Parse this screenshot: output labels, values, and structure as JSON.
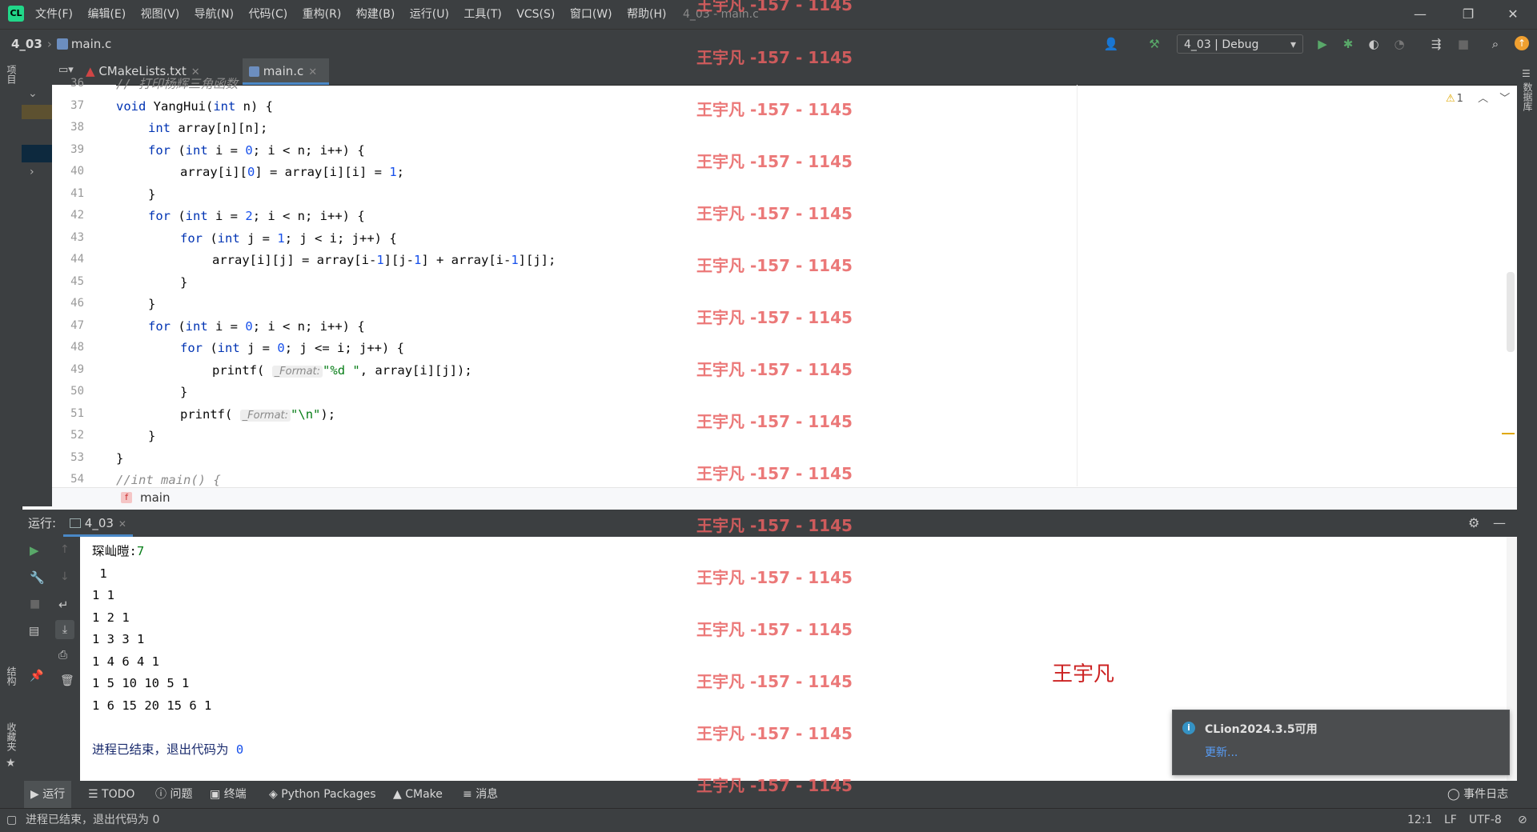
{
  "titlebar": {
    "menu": [
      "文件(F)",
      "编辑(E)",
      "视图(V)",
      "导航(N)",
      "代码(C)",
      "重构(R)",
      "构建(B)",
      "运行(U)",
      "工具(T)",
      "VCS(S)",
      "窗口(W)",
      "帮助(H)"
    ],
    "window_title": "4_03 - main.c",
    "minimize": "—",
    "restore": "❐",
    "close": "✕"
  },
  "navbar": {
    "project": "4_03",
    "file": "main.c",
    "run_config": "4_03 | Debug"
  },
  "left_strip": {
    "project_label": "项目",
    "structure_label": "结构",
    "bookmarks_label": "收藏夹"
  },
  "right_strip": {
    "database_label": "数据库"
  },
  "tabs": [
    {
      "label": "CMakeLists.txt"
    },
    {
      "label": "main.c"
    }
  ],
  "editor": {
    "warning_count": "1",
    "line_numbers": [
      "36",
      "37",
      "38",
      "39",
      "40",
      "41",
      "42",
      "43",
      "44",
      "45",
      "46",
      "47",
      "48",
      "49",
      "50",
      "51",
      "52",
      "53",
      "54"
    ],
    "hint_format": "_Format:",
    "breadcrumb_fn": "main",
    "breadcrumb_badge": "f",
    "code": {
      "l36": "// 打印杨辉三角函数",
      "l37_kw": "void",
      "l37_rest": " YangHui(",
      "l37_kw2": "int",
      "l37_end": " n) {",
      "l38_kw": "int",
      "l38_rest": " array[n][n];",
      "l39_a": "for",
      "l39_b": " (",
      "l39_c": "int",
      "l39_d": " i = ",
      "l39_e": "0",
      "l39_f": "; i < n; i++) {",
      "l40_a": "array[i][",
      "l40_b": "0",
      "l40_c": "] = array[i][i] = ",
      "l40_d": "1",
      "l40_e": ";",
      "l41": "}",
      "l42_a": "for",
      "l42_b": " (",
      "l42_c": "int",
      "l42_d": " i = ",
      "l42_e": "2",
      "l42_f": "; i < n; i++) {",
      "l43_a": "for",
      "l43_b": " (",
      "l43_c": "int",
      "l43_d": " j = ",
      "l43_e": "1",
      "l43_f": "; j < i; j++) {",
      "l44_a": "array[i][j] = array[i-",
      "l44_b": "1",
      "l44_c": "][j-",
      "l44_d": "1",
      "l44_e": "] + array[i-",
      "l44_f": "1",
      "l44_g": "][j];",
      "l45": "}",
      "l46": "}",
      "l47_a": "for",
      "l47_b": " (",
      "l47_c": "int",
      "l47_d": " i = ",
      "l47_e": "0",
      "l47_f": "; i < n; i++) {",
      "l48_a": "for",
      "l48_b": " (",
      "l48_c": "int",
      "l48_d": " j = ",
      "l48_e": "0",
      "l48_f": "; j <= i; j++) {",
      "l49_a": "printf( ",
      "l49_b": "\"%d \"",
      "l49_c": ", array[i][j]);",
      "l50": "}",
      "l51_a": "printf( ",
      "l51_b": "\"\\n\"",
      "l51_c": ");",
      "l52": "}",
      "l53": "}",
      "l54": "//int main() {"
    }
  },
  "run_panel": {
    "label": "运行:",
    "tab": "4_03",
    "output": [
      {
        "text": "琛屾暟:",
        "input": "7"
      },
      {
        "text": " 1"
      },
      {
        "text": "1 1"
      },
      {
        "text": "1 2 1"
      },
      {
        "text": "1 3 3 1"
      },
      {
        "text": "1 4 6 4 1"
      },
      {
        "text": "1 5 10 10 5 1"
      },
      {
        "text": "1 6 15 20 15 6 1"
      },
      {
        "text": ""
      },
      {
        "text": "进程已结束，退出代码为 ",
        "code": "0"
      }
    ]
  },
  "bottom_tools": {
    "run": "运行",
    "todo": "TODO",
    "problems": "问题",
    "terminal": "终端",
    "python_packages": "Python Packages",
    "cmake": "CMake",
    "messages": "消息",
    "event_log": "事件日志"
  },
  "statusbar": {
    "message": "进程已结束，退出代码为 0",
    "position": "12:1",
    "line_sep": "LF",
    "encoding": "UTF-8"
  },
  "notification": {
    "title": "CLion2024.3.5可用",
    "link": "更新..."
  },
  "watermark": {
    "text": "王宇凡 -157 - 1145",
    "name": "王宇凡"
  },
  "colors": {
    "chrome": "#3c3f41",
    "accent": "#4a88c7",
    "keyword": "#0033b3",
    "number": "#1750eb",
    "string": "#067d17",
    "watermark": "#e86161",
    "run_green": "#59a869"
  }
}
